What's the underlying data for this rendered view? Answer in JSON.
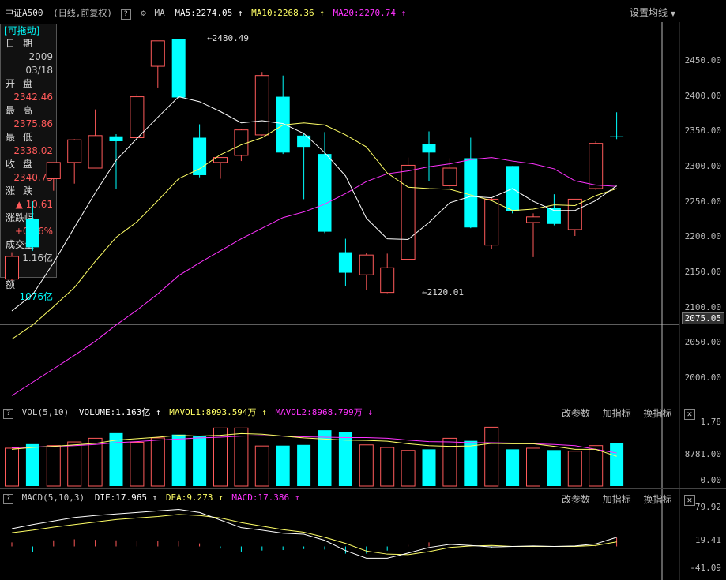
{
  "header": {
    "index_name": "中证A500",
    "mode": "(日线,前复权)",
    "help_icon": "?",
    "settings_icon": "gear-icon",
    "ma_label": "MA",
    "ma5": "MA5:2274.05",
    "ma10": "MA10:2268.36",
    "ma20": "MA20:2270.74",
    "arrow": "↑",
    "setting_ma": "设置均线"
  },
  "colors": {
    "up": "#ff5a5a",
    "down": "#00ffff",
    "ma5": "#ffffff",
    "ma10": "#ffff66",
    "ma20": "#ff33ff",
    "text_red": "#ff5a5a",
    "text_cyan": "#00ffff"
  },
  "sidebar": {
    "drag": "[可拖动]",
    "date_label": "日期",
    "date_year": "2009",
    "date_md": "03/18",
    "open_label": "开盘",
    "open": "2342.46",
    "high_label": "最高",
    "high": "2375.86",
    "low_label": "最低",
    "low": "2338.02",
    "close_label": "收盘",
    "close": "2340.73",
    "chg_label": "涨跌",
    "chg": "▲ 10.61",
    "pct_label": "涨跌幅",
    "pct": "+0.46%",
    "vol_label": "成交量",
    "vol": "1.16亿",
    "amt_label": "金额",
    "amt": "1076亿"
  },
  "price_axis": {
    "ticks": [
      "2450.00",
      "2400.00",
      "2350.00",
      "2300.00",
      "2250.00",
      "2200.00",
      "2150.00",
      "2100.00",
      "2050.00",
      "2000.00"
    ],
    "cursor": "2075.05"
  },
  "annotations": {
    "high": "2480.49",
    "low": "2120.01"
  },
  "volume_panel": {
    "title": "VOL(5,10)",
    "volume": "VOLUME:1.163亿",
    "mavol1": "MAVOL1:8093.594万",
    "mavol2": "MAVOL2:8968.799万",
    "up_arrow": "↑",
    "down_arrow": "↓",
    "ticks": [
      "1.78",
      "8781.00",
      "0.00"
    ],
    "btn_params": "改参数",
    "btn_add": "加指标",
    "btn_switch": "换指标"
  },
  "macd_panel": {
    "title": "MACD(5,10,3)",
    "dif": "DIF:17.965",
    "dea": "DEA:9.273",
    "macd": "MACD:17.386",
    "arrow": "↑",
    "ticks": [
      "79.92",
      "19.41",
      "-41.09"
    ],
    "btn_params": "改参数",
    "btn_add": "加指标",
    "btn_switch": "换指标"
  },
  "chart_data": [
    {
      "type": "candlestick",
      "ylim": [
        1960,
        2490
      ],
      "candles": [
        {
          "o": 2140,
          "h": 2178,
          "l": 2138,
          "c": 2172
        },
        {
          "o": 2225,
          "h": 2250,
          "l": 2180,
          "c": 2185
        },
        {
          "o": 2282,
          "h": 2300,
          "l": 2265,
          "c": 2305
        },
        {
          "o": 2305,
          "h": 2338,
          "l": 2275,
          "c": 2337
        },
        {
          "o": 2297,
          "h": 2380,
          "l": 2297,
          "c": 2343
        },
        {
          "o": 2342,
          "h": 2345,
          "l": 2268,
          "c": 2335
        },
        {
          "o": 2340,
          "h": 2402,
          "l": 2338,
          "c": 2398
        },
        {
          "o": 2441,
          "h": 2476,
          "l": 2411,
          "c": 2477
        },
        {
          "o": 2480,
          "h": 2480,
          "l": 2397,
          "c": 2397
        },
        {
          "o": 2340,
          "h": 2359,
          "l": 2284,
          "c": 2287
        },
        {
          "o": 2305,
          "h": 2312,
          "l": 2282,
          "c": 2312
        },
        {
          "o": 2315,
          "h": 2352,
          "l": 2307,
          "c": 2351
        },
        {
          "o": 2344,
          "h": 2433,
          "l": 2343,
          "c": 2428
        },
        {
          "o": 2398,
          "h": 2428,
          "l": 2317,
          "c": 2319
        },
        {
          "o": 2343,
          "h": 2347,
          "l": 2253,
          "c": 2327
        },
        {
          "o": 2317,
          "h": 2348,
          "l": 2205,
          "c": 2207
        },
        {
          "o": 2178,
          "h": 2197,
          "l": 2130,
          "c": 2149
        },
        {
          "o": 2146,
          "h": 2177,
          "l": 2125,
          "c": 2174
        },
        {
          "o": 2121,
          "h": 2176,
          "l": 2120,
          "c": 2156
        },
        {
          "o": 2168,
          "h": 2312,
          "l": 2168,
          "c": 2301
        },
        {
          "o": 2331,
          "h": 2349,
          "l": 2278,
          "c": 2319
        },
        {
          "o": 2272,
          "h": 2311,
          "l": 2267,
          "c": 2297
        },
        {
          "o": 2311,
          "h": 2340,
          "l": 2212,
          "c": 2213
        },
        {
          "o": 2188,
          "h": 2255,
          "l": 2183,
          "c": 2253
        },
        {
          "o": 2300,
          "h": 2300,
          "l": 2233,
          "c": 2236
        },
        {
          "o": 2220,
          "h": 2233,
          "l": 2171,
          "c": 2228
        },
        {
          "o": 2241,
          "h": 2260,
          "l": 2216,
          "c": 2218
        },
        {
          "o": 2210,
          "h": 2253,
          "l": 2201,
          "c": 2253
        },
        {
          "o": 2268,
          "h": 2335,
          "l": 2266,
          "c": 2332
        },
        {
          "o": 2342,
          "h": 2376,
          "l": 2338,
          "c": 2341
        }
      ],
      "ma5": [
        2095,
        2118,
        2163,
        2213,
        2262,
        2308,
        2339,
        2369,
        2398,
        2391,
        2377,
        2361,
        2364,
        2360,
        2346,
        2319,
        2286,
        2226,
        2197,
        2196,
        2220,
        2248,
        2257,
        2255,
        2268,
        2250,
        2237,
        2237,
        2251,
        2272
      ],
      "ma10": [
        2055,
        2075,
        2101,
        2128,
        2165,
        2199,
        2221,
        2251,
        2282,
        2296,
        2316,
        2330,
        2340,
        2358,
        2361,
        2358,
        2344,
        2327,
        2290,
        2270,
        2268,
        2267,
        2259,
        2251,
        2237,
        2239,
        2245,
        2244,
        2258,
        2268
      ],
      "ma20": [
        1975,
        1994,
        2013,
        2032,
        2052,
        2075,
        2096,
        2119,
        2145,
        2163,
        2180,
        2197,
        2212,
        2227,
        2235,
        2246,
        2261,
        2278,
        2289,
        2293,
        2299,
        2303,
        2309,
        2312,
        2307,
        2303,
        2296,
        2279,
        2273,
        2271
      ]
    },
    {
      "type": "bar",
      "name": "VOL",
      "ylim": [
        0,
        1.78
      ],
      "values": [
        1.03,
        1.14,
        1.1,
        1.2,
        1.3,
        1.44,
        1.19,
        1.31,
        1.4,
        1.35,
        1.58,
        1.58,
        1.09,
        1.1,
        1.12,
        1.52,
        1.47,
        1.12,
        1.05,
        0.97,
        1.0,
        1.3,
        1.23,
        1.6,
        1.0,
        1.03,
        0.98,
        0.95,
        1.1,
        1.16
      ],
      "mavol1": [
        1.0,
        1.05,
        1.08,
        1.12,
        1.16,
        1.25,
        1.29,
        1.33,
        1.38,
        1.36,
        1.38,
        1.43,
        1.41,
        1.36,
        1.31,
        1.28,
        1.25,
        1.24,
        1.22,
        1.15,
        1.1,
        1.08,
        1.09,
        1.16,
        1.15,
        1.15,
        1.08,
        1.0,
        1.0,
        0.81
      ],
      "mavol2": [
        1.04,
        1.06,
        1.08,
        1.1,
        1.13,
        1.18,
        1.21,
        1.25,
        1.28,
        1.31,
        1.33,
        1.36,
        1.37,
        1.36,
        1.34,
        1.33,
        1.32,
        1.32,
        1.3,
        1.25,
        1.21,
        1.2,
        1.18,
        1.18,
        1.17,
        1.15,
        1.13,
        1.1,
        1.0,
        0.9
      ]
    },
    {
      "type": "line",
      "name": "MACD",
      "ylim": [
        -41.09,
        79.92
      ],
      "dif": [
        35,
        43,
        50,
        57,
        61,
        64,
        67,
        70,
        73,
        67,
        52,
        37,
        32,
        26,
        24,
        12,
        -8,
        -23,
        -23,
        -13,
        -2,
        4,
        2,
        -1,
        0,
        1,
        0,
        1,
        5,
        18
      ],
      "dea": [
        27,
        32,
        38,
        43,
        48,
        53,
        56,
        59,
        63,
        61,
        56,
        47,
        40,
        33,
        28,
        18,
        6,
        -9,
        -15,
        -16,
        -10,
        -2,
        1,
        2,
        0,
        0,
        0,
        0,
        2,
        9
      ],
      "macd": [
        8,
        -11,
        12,
        14,
        13,
        12,
        11,
        11,
        10,
        6,
        -4,
        -10,
        -8,
        -7,
        -5,
        -6,
        -14,
        -14,
        -8,
        3,
        8,
        6,
        1,
        -3,
        0,
        1,
        0,
        1,
        3,
        17
      ]
    }
  ]
}
